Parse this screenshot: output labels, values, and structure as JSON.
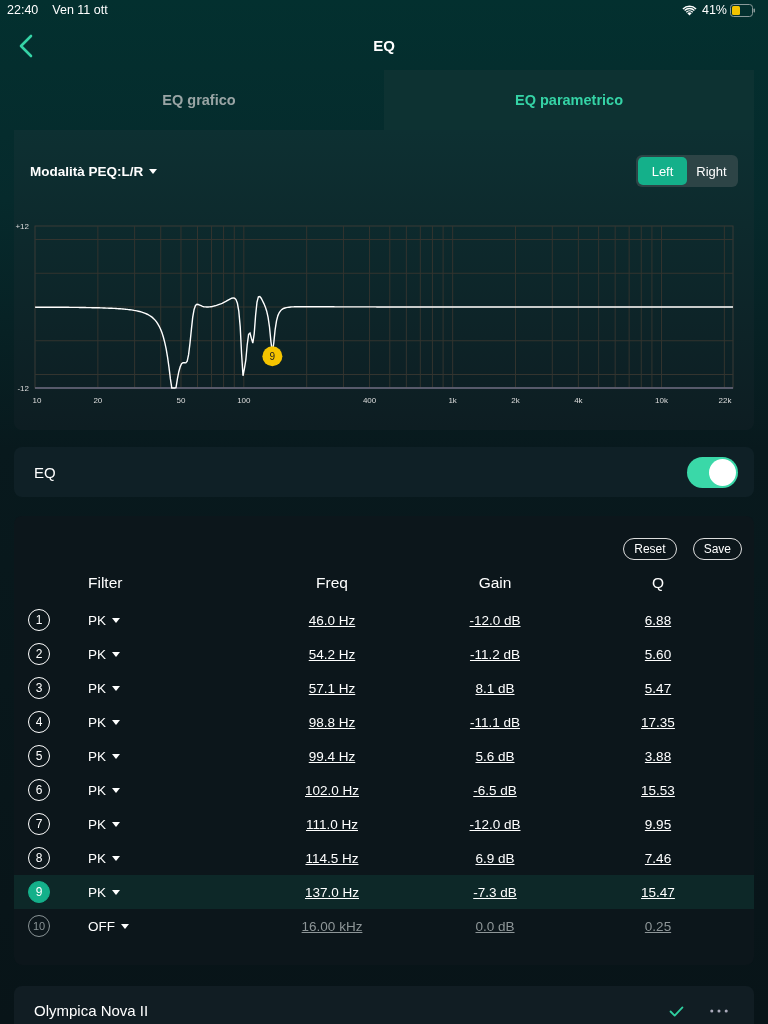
{
  "status_bar": {
    "time": "22:40",
    "date": "Ven 11 ott",
    "battery": "41%"
  },
  "nav": {
    "title": "EQ"
  },
  "tabs": [
    {
      "label": "EQ grafico",
      "selected": false
    },
    {
      "label": "EQ parametrico",
      "selected": true
    }
  ],
  "mode": {
    "label": "Modalità PEQ:L/R"
  },
  "channels": [
    {
      "label": "Left",
      "selected": true
    },
    {
      "label": "Right",
      "selected": false
    }
  ],
  "chart": {
    "marker_label": "9",
    "y_labels": [
      "+12",
      "-12"
    ],
    "x_labels": [
      "10",
      "20",
      "50",
      "100",
      "400",
      "1k",
      "2k",
      "4k",
      "10k",
      "22k"
    ]
  },
  "eq": {
    "label": "EQ",
    "on": true
  },
  "actions": [
    "Reset",
    "Save"
  ],
  "columns": [
    "Filter",
    "Freq",
    "Gain",
    "Q"
  ],
  "filters": [
    {
      "index": "1",
      "type": "PK",
      "freq": "46.0 Hz",
      "gain": "-12.0 dB",
      "q": "6.88",
      "active": true,
      "selected": false
    },
    {
      "index": "2",
      "type": "PK",
      "freq": "54.2 Hz",
      "gain": "-11.2 dB",
      "q": "5.60",
      "active": true,
      "selected": false
    },
    {
      "index": "3",
      "type": "PK",
      "freq": "57.1 Hz",
      "gain": "8.1 dB",
      "q": "5.47",
      "active": true,
      "selected": false
    },
    {
      "index": "4",
      "type": "PK",
      "freq": "98.8 Hz",
      "gain": "-11.1 dB",
      "q": "17.35",
      "active": true,
      "selected": false
    },
    {
      "index": "5",
      "type": "PK",
      "freq": "99.4 Hz",
      "gain": "5.6 dB",
      "q": "3.88",
      "active": true,
      "selected": false
    },
    {
      "index": "6",
      "type": "PK",
      "freq": "102.0 Hz",
      "gain": "-6.5 dB",
      "q": "15.53",
      "active": true,
      "selected": false
    },
    {
      "index": "7",
      "type": "PK",
      "freq": "111.0 Hz",
      "gain": "-12.0 dB",
      "q": "9.95",
      "active": true,
      "selected": false
    },
    {
      "index": "8",
      "type": "PK",
      "freq": "114.5 Hz",
      "gain": "6.9 dB",
      "q": "7.46",
      "active": true,
      "selected": false
    },
    {
      "index": "9",
      "type": "PK",
      "freq": "137.0 Hz",
      "gain": "-7.3 dB",
      "q": "15.47",
      "active": true,
      "selected": true
    },
    {
      "index": "10",
      "type": "OFF",
      "freq": "16.00 kHz",
      "gain": "0.0 dB",
      "q": "0.25",
      "active": false,
      "selected": false
    }
  ],
  "device": {
    "name": "Olympica Nova II",
    "checked": true
  }
}
